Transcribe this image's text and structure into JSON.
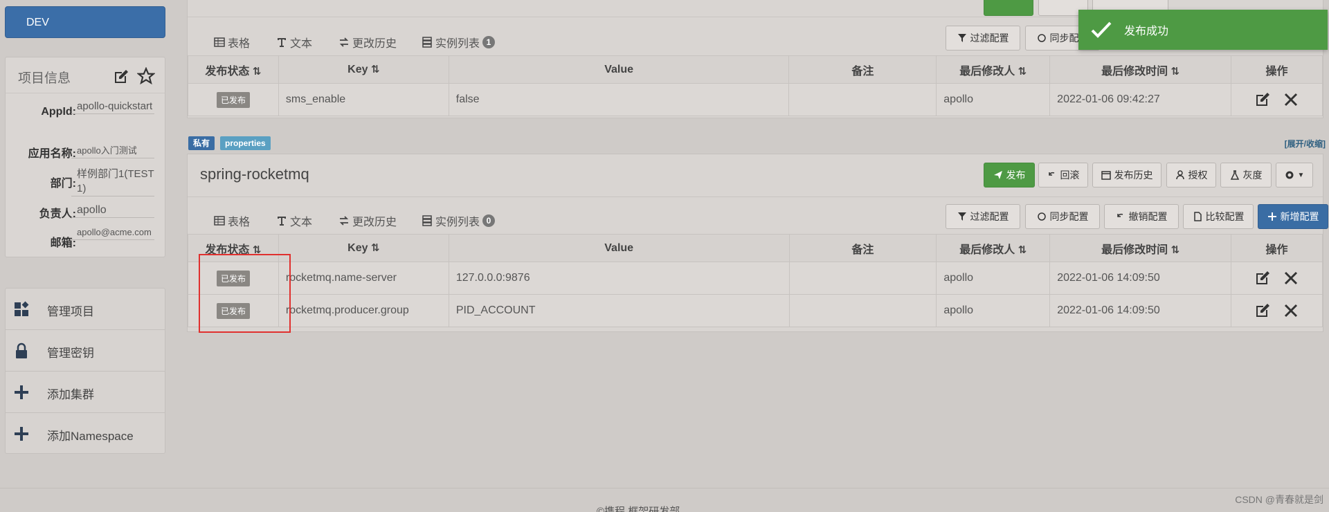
{
  "sidebar": {
    "env": "DEV",
    "project_info": {
      "title": "项目信息",
      "rows": [
        {
          "label": "AppId:",
          "value": "apollo-quickstart"
        },
        {
          "label": "应用名称:",
          "value": "apollo入门测试"
        },
        {
          "label": "部门:",
          "value": "样例部门1(TEST1)"
        },
        {
          "label": "负责人:",
          "value": "apollo"
        },
        {
          "label": "邮箱:",
          "value": "apollo@acme.com"
        }
      ]
    },
    "menu": [
      {
        "label": "管理项目",
        "icon": "grid-icon"
      },
      {
        "label": "管理密钥",
        "icon": "lock-icon"
      },
      {
        "label": "添加集群",
        "icon": "plus-icon"
      },
      {
        "label": "添加Namespace",
        "icon": "plus-icon"
      }
    ]
  },
  "top_panel": {
    "tabs": {
      "table": "表格",
      "text": "文本",
      "history": "更改历史",
      "instances": "实例列表",
      "instance_count": "1"
    },
    "buttons": {
      "filter": "过滤配置",
      "sync": "同步配置"
    },
    "columns": [
      "发布状态",
      "Key",
      "Value",
      "备注",
      "最后修改人",
      "最后修改时间",
      "操作"
    ],
    "rows": [
      {
        "status": "已发布",
        "key": "sms_enable",
        "value": "false",
        "comment": "",
        "modifier": "apollo",
        "time": "2022-01-06 09:42:27"
      }
    ]
  },
  "bottom_panel": {
    "labels": {
      "private": "私有",
      "format": "properties"
    },
    "expand": "[展开/收缩]",
    "name": "spring-rocketmq",
    "head_buttons": {
      "publish": "发布",
      "rollback": "回滚",
      "history": "发布历史",
      "auth": "授权",
      "gray": "灰度"
    },
    "tabs": {
      "table": "表格",
      "text": "文本",
      "history": "更改历史",
      "instances": "实例列表",
      "instance_count": "0"
    },
    "buttons": {
      "filter": "过滤配置",
      "sync": "同步配置",
      "revoke": "撤销配置",
      "compare": "比较配置",
      "add": "新增配置"
    },
    "columns": [
      "发布状态",
      "Key",
      "Value",
      "备注",
      "最后修改人",
      "最后修改时间",
      "操作"
    ],
    "rows": [
      {
        "status": "已发布",
        "key": "rocketmq.name-server",
        "value": "127.0.0.0:9876",
        "comment": "",
        "modifier": "apollo",
        "time": "2022-01-06 14:09:50"
      },
      {
        "status": "已发布",
        "key": "rocketmq.producer.group",
        "value": "PID_ACCOUNT",
        "comment": "",
        "modifier": "apollo",
        "time": "2022-01-06 14:09:50"
      }
    ]
  },
  "toast": {
    "message": "发布成功"
  },
  "footer": {
    "text": "©携程 框架研发部"
  },
  "watermark": "CSDN @青春就是剑",
  "colors": {
    "primary": "#3a6da4",
    "success": "#4e9a44",
    "highlight_box": "#e0302e"
  }
}
